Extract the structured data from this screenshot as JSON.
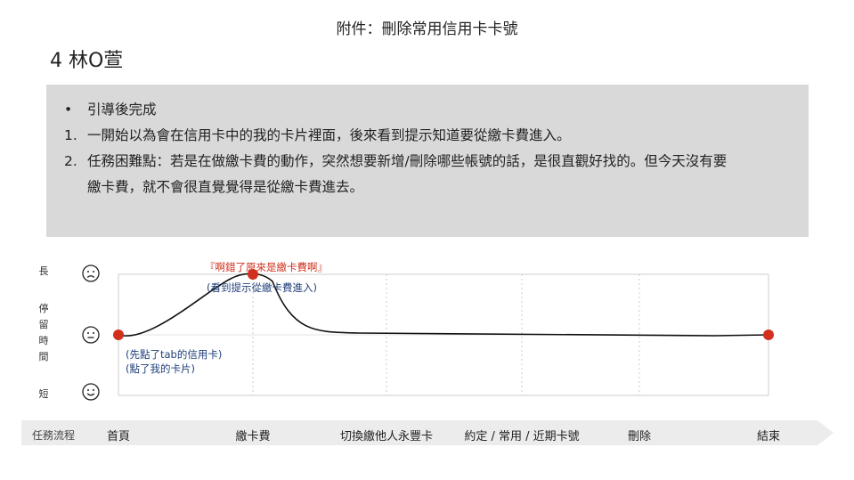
{
  "header": {
    "title": "附件：刪除常用信用卡卡號",
    "persona": "4 林O萱"
  },
  "notes": {
    "bullet": "引導後完成",
    "items": [
      {
        "marker": "1.",
        "text": "一開始以為會在信用卡中的我的卡片裡面，後來看到提示知道要從繳卡費進入。"
      },
      {
        "marker": "2.",
        "text": "任務困難點：若是在做繳卡費的動作，突然想要新增/刪除哪些帳號的話，是很直觀好找的。但今天沒有要",
        "continuation": "繳卡費，就不會很直覺覺得是從繳卡費進去。"
      }
    ]
  },
  "y_axis": {
    "top_label": "長",
    "middle_label": [
      "停",
      "留",
      "時",
      "間"
    ],
    "bottom_label": "短",
    "faces": [
      "sad-face-icon",
      "neutral-face-icon",
      "happy-face-icon"
    ]
  },
  "annotations": {
    "peak_quote": "『啊錯了原來是繳卡費啊』",
    "peak_note": "(看到提示從繳卡費進入)",
    "start_note_1": "(先點了tab的信用卡)",
    "start_note_2": "(點了我的卡片)"
  },
  "flow": {
    "bar_title": "任務流程",
    "steps": [
      "首頁",
      "繳卡費",
      "切換繳他人永豐卡",
      "約定 / 常用 / 近期卡號",
      "刪除",
      "結束"
    ]
  },
  "chart_data": {
    "type": "line",
    "categories": [
      "首頁",
      "繳卡費",
      "切換繳他人永豐卡",
      "約定 / 常用 / 近期卡號",
      "刪除",
      "結束"
    ],
    "series": [
      {
        "values": [
          0,
          1,
          0,
          0,
          0,
          0
        ]
      }
    ],
    "ylim": [
      -1,
      1
    ],
    "markers_at": [
      "首頁",
      "繳卡費",
      "結束"
    ],
    "colors": {
      "line": "#111111",
      "marker": "#d0301c",
      "grid": "#cccccc"
    }
  }
}
